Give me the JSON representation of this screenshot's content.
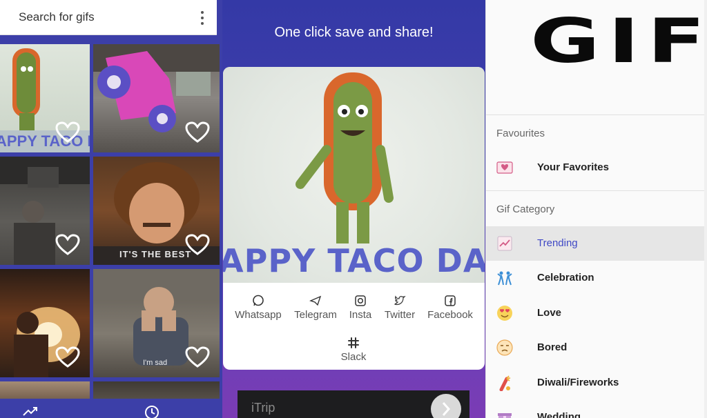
{
  "search": {
    "placeholder": "Search for gifs"
  },
  "grid": {
    "tiles": [
      {
        "caption": "APPY TACO DAY"
      },
      {
        "caption": ""
      },
      {
        "caption": ""
      },
      {
        "caption": "IT'S THE BEST"
      },
      {
        "caption": ""
      },
      {
        "caption": "I'm sad"
      }
    ]
  },
  "bottom_nav": {
    "icons": [
      "trending-icon",
      "clock-icon"
    ]
  },
  "headline": "One click save and share!",
  "preview": {
    "caption": "APPY TACO DAY"
  },
  "share": {
    "items": [
      {
        "label": "Whatsapp",
        "icon": "whatsapp-icon"
      },
      {
        "label": "Telegram",
        "icon": "telegram-icon"
      },
      {
        "label": "Insta",
        "icon": "instagram-icon"
      },
      {
        "label": "Twitter",
        "icon": "twitter-icon"
      },
      {
        "label": "Facebook",
        "icon": "facebook-icon"
      },
      {
        "label": "Slack",
        "icon": "slack-icon"
      }
    ]
  },
  "ad": {
    "text": "iTrip"
  },
  "drawer": {
    "logo": "GIF",
    "favourites_title": "Favourites",
    "favourites": [
      {
        "label": "Your Favorites",
        "icon": "heart-box-icon"
      }
    ],
    "category_title": "Gif Category",
    "categories": [
      {
        "label": "Trending",
        "icon": "trending-chart-icon",
        "active": true
      },
      {
        "label": "Celebration",
        "icon": "celebration-icon"
      },
      {
        "label": "Love",
        "icon": "heart-eyes-emoji-icon"
      },
      {
        "label": "Bored",
        "icon": "bored-emoji-icon"
      },
      {
        "label": "Diwali/Fireworks",
        "icon": "firework-icon"
      },
      {
        "label": "Wedding",
        "icon": "gift-icon"
      }
    ]
  },
  "colors": {
    "accent": "#3f48c5",
    "nav_bg": "#3c3fa8",
    "active_bg": "#e6e6e6"
  }
}
